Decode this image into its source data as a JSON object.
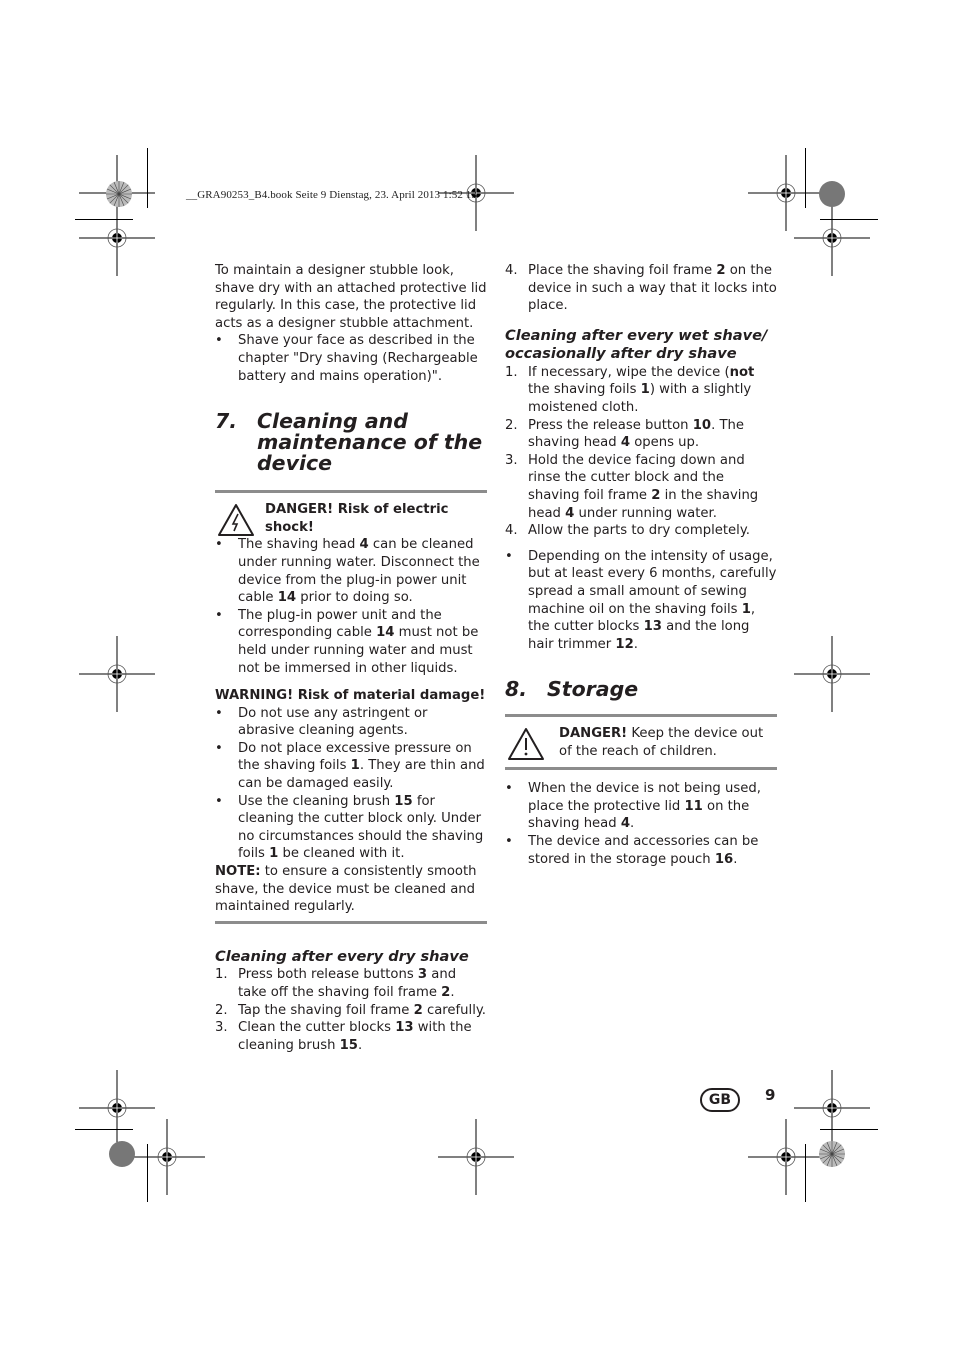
{
  "print_slug": "__GRA90253_B4.book  Seite 9  Dienstag, 23. April 2013  1:52 13",
  "left_column": {
    "intro": "To maintain a designer stubble look, shave dry with an attached protective lid regularly. In this case, the protective lid acts as a designer stubble attachment.",
    "intro_bullets": [
      {
        "text": "Shave your face as described in the chapter \"Dry shaving (Rechargeable battery and mains operation)\"."
      }
    ],
    "section7": {
      "number": "7.",
      "title": "Cleaning and maintenance of the device",
      "danger": {
        "icon": "electric-shock-warning-icon",
        "label": "DANGER! Risk of electric shock!"
      },
      "danger_bullets": [
        [
          "The shaving head ",
          {
            "b": "4"
          },
          " can be cleaned under running water. Disconnect the device from the plug-in power unit cable ",
          {
            "b": "14"
          },
          " prior to doing so."
        ],
        [
          "The plug-in power unit and the corresponding cable ",
          {
            "b": "14"
          },
          " must not be held under running water and must not be immersed in other liquids."
        ]
      ],
      "warning_label": "WARNING! Risk of material damage!",
      "warning_bullets": [
        [
          "Do not use any astringent or abrasive cleaning agents."
        ],
        [
          "Do not place excessive pressure on the shaving foils ",
          {
            "b": "1"
          },
          ". They are thin and can be damaged easily."
        ],
        [
          "Use the cleaning brush ",
          {
            "b": "15"
          },
          " for cleaning the cutter block only. Under no circumstances should the shaving foils ",
          {
            "b": "1"
          },
          " be cleaned with it."
        ]
      ],
      "note_label": "NOTE:",
      "note_text": " to ensure a consistently smooth shave, the device must be cleaned and maintained regularly."
    },
    "dry_shave": {
      "heading": "Cleaning after every dry shave",
      "steps": [
        {
          "n": "1.",
          "parts": [
            "Press both release buttons ",
            {
              "b": "3"
            },
            " and take off the shaving foil frame ",
            {
              "b": "2"
            },
            "."
          ]
        },
        {
          "n": "2.",
          "parts": [
            "Tap the shaving foil frame ",
            {
              "b": "2"
            },
            " carefully."
          ]
        },
        {
          "n": "3.",
          "parts": [
            "Clean the cutter blocks ",
            {
              "b": "13"
            },
            " with the cleaning brush ",
            {
              "b": "15"
            },
            "."
          ]
        }
      ]
    }
  },
  "right_column": {
    "dry_shave_cont": [
      {
        "n": "4.",
        "parts": [
          "Place the shaving foil frame ",
          {
            "b": "2"
          },
          " on the device in such a way that it locks into place."
        ]
      }
    ],
    "wet_shave": {
      "heading": "Cleaning after every wet shave/ occasionally after dry shave",
      "steps": [
        {
          "n": "1.",
          "parts": [
            "If necessary, wipe the device (",
            {
              "b": "not"
            },
            " the shaving foils ",
            {
              "b": "1"
            },
            ") with a slightly moistened cloth."
          ]
        },
        {
          "n": "2.",
          "parts": [
            "Press the release button ",
            {
              "b": "10"
            },
            ". The shaving head ",
            {
              "b": "4"
            },
            " opens up."
          ]
        },
        {
          "n": "3.",
          "parts": [
            "Hold the device facing down and rinse the cutter block and the shaving foil frame ",
            {
              "b": "2"
            },
            " in the shaving head ",
            {
              "b": "4"
            },
            " under running water."
          ]
        },
        {
          "n": "4.",
          "parts": [
            "Allow the parts to dry completely."
          ]
        }
      ],
      "bullets": [
        [
          "Depending on the intensity of usage, but at least every 6 months, carefully spread a small amount of sewing machine oil on the shaving foils ",
          {
            "b": "1"
          },
          ", the cutter blocks ",
          {
            "b": "13"
          },
          " and the long hair trimmer ",
          {
            "b": "12"
          },
          "."
        ]
      ]
    },
    "section8": {
      "number": "8.",
      "title": "Storage",
      "danger": {
        "icon": "warning-triangle-icon",
        "label": "DANGER!",
        "text": " Keep the device out of the reach of children."
      },
      "bullets": [
        [
          "When the device is not being used, place the protective lid ",
          {
            "b": "11"
          },
          " on the shaving head ",
          {
            "b": "4"
          },
          "."
        ],
        [
          "The device and accessories can be stored in the storage pouch ",
          {
            "b": "16"
          },
          "."
        ]
      ]
    }
  },
  "footer": {
    "language_badge": "GB",
    "page_number": "9"
  },
  "marks": {
    "bullet": "•"
  }
}
